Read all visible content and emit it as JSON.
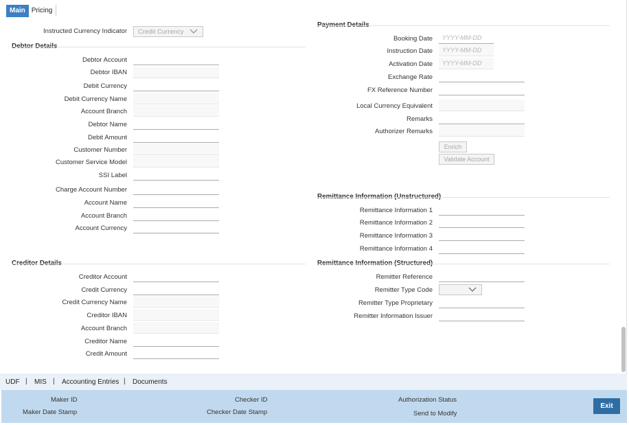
{
  "tabs": {
    "main": "Main",
    "pricing": "Pricing"
  },
  "instructed": {
    "label": "Instructed Currency Indicator",
    "value": "Credit Currency"
  },
  "debtor": {
    "title": "Debtor Details",
    "fields": [
      "Debtor Account",
      "Debtor IBAN",
      "Debit Currency",
      "Debit Currency Name",
      "Account Branch",
      "Debtor Name",
      "Debit Amount",
      "Customer Number",
      "Customer Service Model",
      "SSI Label",
      "Charge Account Number",
      "Account Name",
      "Account Branch",
      "Account Currency"
    ]
  },
  "creditor": {
    "title": "Creditor Details",
    "fields": [
      "Creditor Account",
      "Credit Currency",
      "Credit Currency Name",
      "Creditor IBAN",
      "Account Branch",
      "Creditor Name",
      "Credit Amount"
    ]
  },
  "payment": {
    "title": "Payment Details",
    "fields": [
      "Booking Date",
      "Instruction Date",
      "Activation Date",
      "Exchange Rate",
      "FX Reference Number",
      "Local Currency Equivalent",
      "Remarks",
      "Authorizer Remarks"
    ],
    "date_placeholder": "YYYY-MM-DD",
    "enrich_button": "Enrich",
    "validate_button": "Validate Account"
  },
  "remit_unstructured": {
    "title": "Remittance Information (Unstructured)",
    "fields": [
      "Remittance Information 1",
      "Remittance Information 2",
      "Remittance Information 3",
      "Remittance Information 4"
    ]
  },
  "remit_structured": {
    "title": "Remittance Information (Structured)",
    "fields": [
      "Remitter Reference",
      "Remitter Type Code",
      "Remitter Type Proprietary",
      "Remitter Information Issuer"
    ]
  },
  "bottom_tabs": {
    "udf": "UDF",
    "mis": "MIS",
    "accounting": "Accounting Entries",
    "documents": "Documents",
    "separator": "|"
  },
  "footer": {
    "maker_id": "Maker ID",
    "maker_date": "Maker Date Stamp",
    "checker_id": "Checker ID",
    "checker_date": "Checker Date Stamp",
    "auth_status": "Authorization Status",
    "send_modify": "Send to Modify",
    "exit": "Exit"
  }
}
